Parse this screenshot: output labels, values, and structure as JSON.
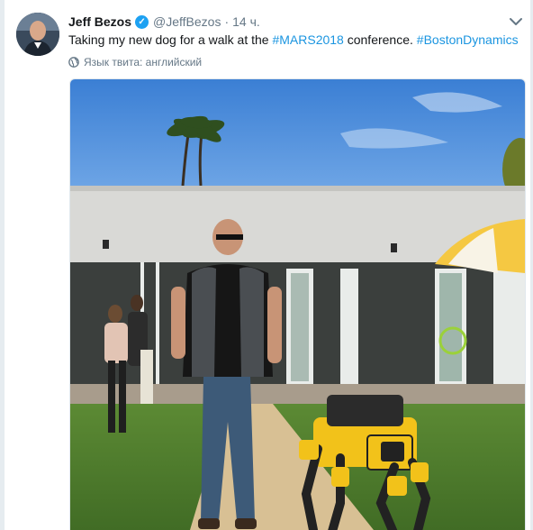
{
  "tweet": {
    "display_name": "Jeff Bezos",
    "handle": "@JeffBezos",
    "separator": "·",
    "time": "14 ч.",
    "text_before": "Taking my new dog for a walk at the ",
    "hashtag1": "#MARS2018",
    "text_middle": " conference. ",
    "hashtag2": "#BostonDynamics",
    "language_note": "Язык твита: английский",
    "verified_icon": "verified-badge-icon",
    "menu_icon": "chevron-down-icon",
    "globe_icon": "globe-icon"
  },
  "colors": {
    "link": "#1b95e0",
    "text": "#14171a",
    "secondary": "#657786",
    "verified": "#1da1f2"
  }
}
